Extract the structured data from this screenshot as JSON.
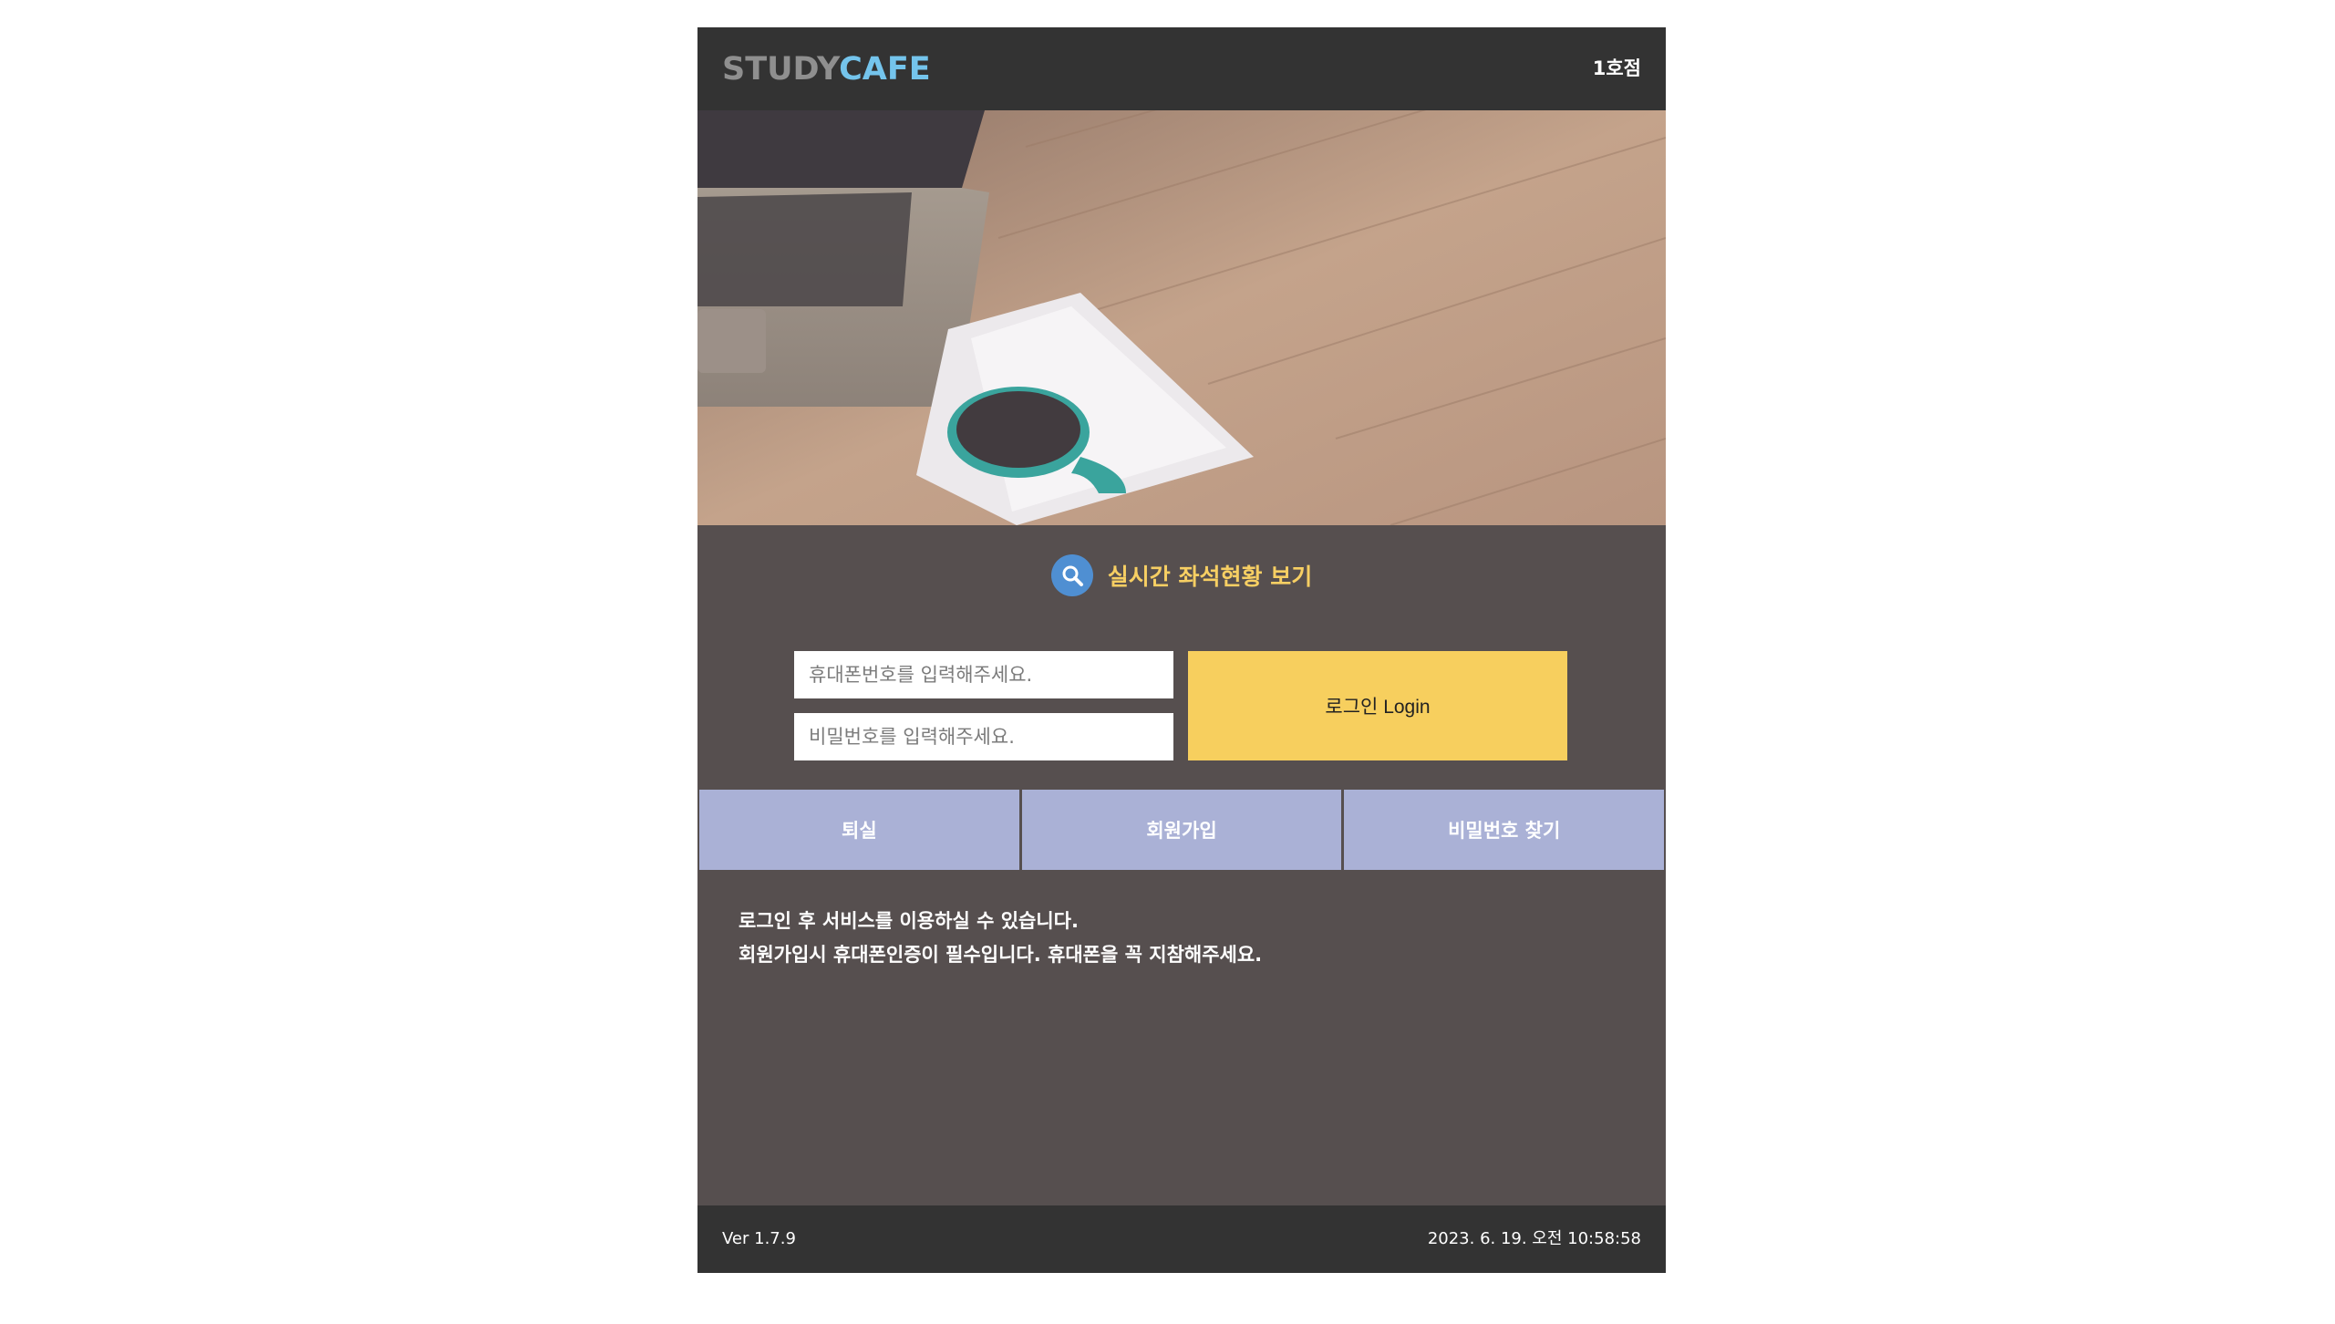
{
  "header": {
    "logo_part1": "STUDY",
    "logo_part2": "CAFE",
    "branch": "1호점"
  },
  "seat_status": {
    "icon": "search-icon",
    "label": "실시간 좌석현황 보기"
  },
  "login_form": {
    "phone_placeholder": "휴대폰번호를 입력해주세요.",
    "password_placeholder": "비밀번호를 입력해주세요.",
    "login_button": "로그인 Login"
  },
  "nav_buttons": [
    {
      "label": "퇴실"
    },
    {
      "label": "회원가입"
    },
    {
      "label": "비밀번호 찾기"
    }
  ],
  "notice": {
    "line1": "로그인 후 서비스를 이용하실 수 있습니다.",
    "line2": "회원가입시 휴대폰인증이 필수입니다. 휴대폰을 꼭 지참해주세요."
  },
  "footer": {
    "version": "Ver 1.7.9",
    "datetime": "2023. 6. 19. 오전 10:58:58"
  },
  "colors": {
    "topbar": "#333333",
    "panel": "#564f4f",
    "accent_yellow": "#f7cf5e",
    "nav_button": "#aab1d6",
    "logo_cafe": "#74c4ec",
    "search_circle": "#4f8fd2"
  }
}
